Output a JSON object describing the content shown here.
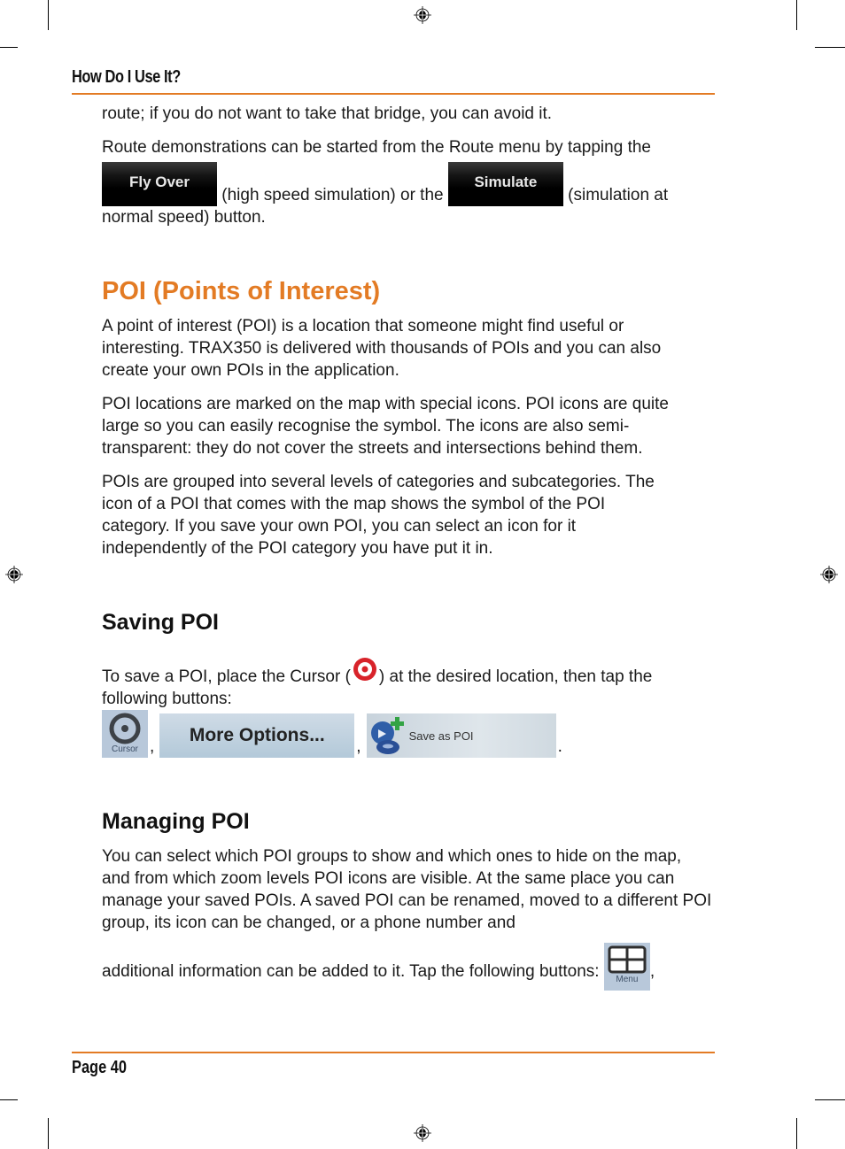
{
  "header": {
    "running_title": "How Do I Use It?"
  },
  "footer": {
    "page_label": "Page 40"
  },
  "colors": {
    "accent": "#e37b24",
    "text": "#1a1a1a"
  },
  "intro": {
    "line1": "route; if you do not want to take that bridge, you can avoid it.",
    "demo_part1": "Route demonstrations can be started from the Route menu by tapping the",
    "fly_over_label": "Fly Over",
    "demo_part2": " (high speed simulation) or the ",
    "simulate_label": "Simulate",
    "demo_part3": " (simulation at",
    "demo_part4": "normal speed) button."
  },
  "poi_section": {
    "title": "POI (Points of Interest)",
    "para1": "A point of interest (POI) is a location that someone might find useful or interesting. TRAX350 is delivered with thousands of POIs and you can also create your own POIs in the application.",
    "para2": "POI locations are marked on the map with special icons. POI icons are quite large so you can easily recognise the symbol. The icons are also semi-transparent: they do not cover the streets and intersections behind them.",
    "para3": "POIs are grouped into several levels of categories and subcategories. The icon of a POI that comes with the map shows the symbol of the POI category. If you save your own POI, you can select an icon for it independently of the POI category you have put it in."
  },
  "saving_poi": {
    "title": "Saving POI",
    "text_part1": "To save a POI, place the Cursor (",
    "text_part2": ") at the desired location, then tap the following buttons:",
    "cursor_icon": "cursor-target-icon",
    "buttons": {
      "cursor_label": "Cursor",
      "more_options_label": "More Options...",
      "save_as_poi_label": "Save as POI"
    },
    "sep": ",",
    "end": "."
  },
  "managing_poi": {
    "title": "Managing POI",
    "para_part1": "You can select which POI groups to show and which ones to hide on the map, and from which zoom levels POI icons are visible. At the same place you can manage your saved POIs. A saved POI can be renamed, moved to a different POI group, its icon can be changed, or a phone number and",
    "para_part2": "additional information can be added to it. Tap the following buttons: ",
    "menu_label": "Menu",
    "sep": ","
  }
}
